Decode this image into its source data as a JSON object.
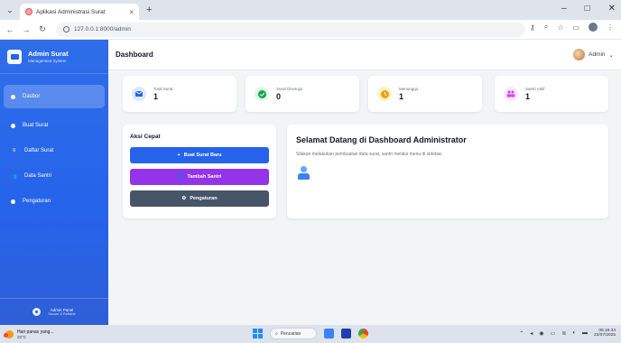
{
  "browser": {
    "tab_title": "Aplikasi Administrasi Surat",
    "url": "127.0.0.1:8000/admin",
    "new_tab_symbol": "+",
    "tab_close_symbol": "×",
    "window_controls": [
      "–",
      "□",
      "✕"
    ]
  },
  "sidebar": {
    "brand_title": "Admin Surat",
    "brand_subtitle": "Management System",
    "items": [
      {
        "label": "Dasbor",
        "icon": "dashboard-icon",
        "active": true
      },
      {
        "label": "Buat Surat",
        "icon": "plus-circle-icon",
        "active": false
      },
      {
        "label": "Daftar Surat",
        "icon": "list-icon",
        "active": false
      },
      {
        "label": "Data Santri",
        "icon": "users-icon",
        "active": false
      },
      {
        "label": "Pengaturan",
        "icon": "gear-icon",
        "active": false
      }
    ],
    "footer_title": "Admin Panel",
    "footer_subtitle": "Secure & Reliable"
  },
  "topbar": {
    "page_title": "Dashboard",
    "user_label": "Admin"
  },
  "stats": [
    {
      "label": "Total Surat",
      "value": "1",
      "color": "#2563eb",
      "icon": "mail-icon"
    },
    {
      "label": "Surat Disetujui",
      "value": "0",
      "color": "#16a34a",
      "icon": "check-icon"
    },
    {
      "label": "Menunggu",
      "value": "1",
      "color": "#f59e0b",
      "icon": "clock-icon"
    },
    {
      "label": "Santri Aktif",
      "value": "1",
      "color": "#d946ef",
      "icon": "users-icon"
    }
  ],
  "quick_actions": {
    "title": "Aksi Cepat",
    "buttons": [
      {
        "label": "Buat Surat Baru",
        "symbol": "+",
        "color": "#2563eb"
      },
      {
        "label": "Tambah Santri",
        "symbol": "👤",
        "color": "#9333ea"
      },
      {
        "label": "Pengaturan",
        "symbol": "⚙",
        "color": "#475569"
      }
    ]
  },
  "welcome": {
    "title": "Selamat Datang di Dashboard Administrator",
    "text": "Silakan melakukan pembuatan data surat, santri melalui menu di sidebar."
  },
  "taskbar": {
    "weather_text": "Hari panas yang...",
    "temperature": "23°C",
    "search_label": "Pencarian",
    "time": "08.19.34",
    "date": "22/07/2025"
  }
}
